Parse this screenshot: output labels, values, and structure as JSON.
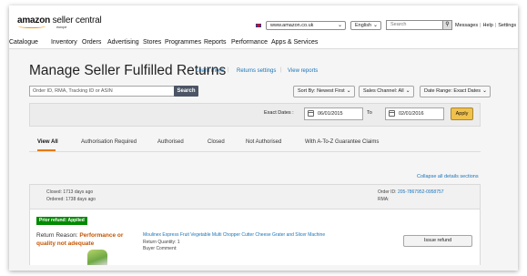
{
  "header": {
    "logo_brand": "amazon",
    "logo_product": " seller central",
    "logo_region": "europe",
    "marketplace": "www.amazon.co.uk",
    "language": "English",
    "search_placeholder": "Search",
    "links": [
      "Messages",
      "Help",
      "Settings"
    ]
  },
  "nav": [
    "Catalogue",
    "Inventory",
    "Orders",
    "Advertising",
    "Stores",
    "Programmes",
    "Reports",
    "Performance",
    "Apps & Services"
  ],
  "page": {
    "title": "Manage Seller Fulfilled Returns",
    "links": [
      "Learn more",
      "Returns settings",
      "View reports"
    ],
    "search_placeholder": "Order ID, RMA, Tracking ID or ASIN",
    "search_button": "Search",
    "sort": "Sort By: Newest First",
    "channel": "Sales Channel: All",
    "date_range": "Date Range: Exact Dates"
  },
  "dates": {
    "label": "Exact Dates :",
    "from": "06/01/2015",
    "to_label": "To",
    "to": "02/01/2016",
    "apply": "Apply"
  },
  "tabs": [
    "View All",
    "Authorisation Required",
    "Authorised",
    "Closed",
    "Not Authorised",
    "With A-To-Z Guarantee Claims"
  ],
  "collapse_link": "Collapse all details sections",
  "order": {
    "closed": "Closed: 1713 days ago",
    "ordered": "Ordered: 1738 days ago",
    "order_id_label": "Order ID:",
    "order_id": "205-7867952-0958757",
    "rma_label": "RMA:",
    "prior_refund": "Prior refund: Applied",
    "reason_label": "Return Reason:",
    "reason_line1": "Performance or",
    "reason_line2": "quality not adequate",
    "product_title": "Moulinex Express Fruit Vegetable Multi Chopper Cutter Cheese Grater and Slicer Machine",
    "quantity": "Return Quantity: 1",
    "buyer_comment": "Buyer Comment:",
    "issue_refund": "Issue refund"
  },
  "colors": {
    "accent_orange": "#e47911",
    "link_blue": "#1a74b8",
    "success_green": "#008a00",
    "apply_yellow": "#f0c14b"
  }
}
